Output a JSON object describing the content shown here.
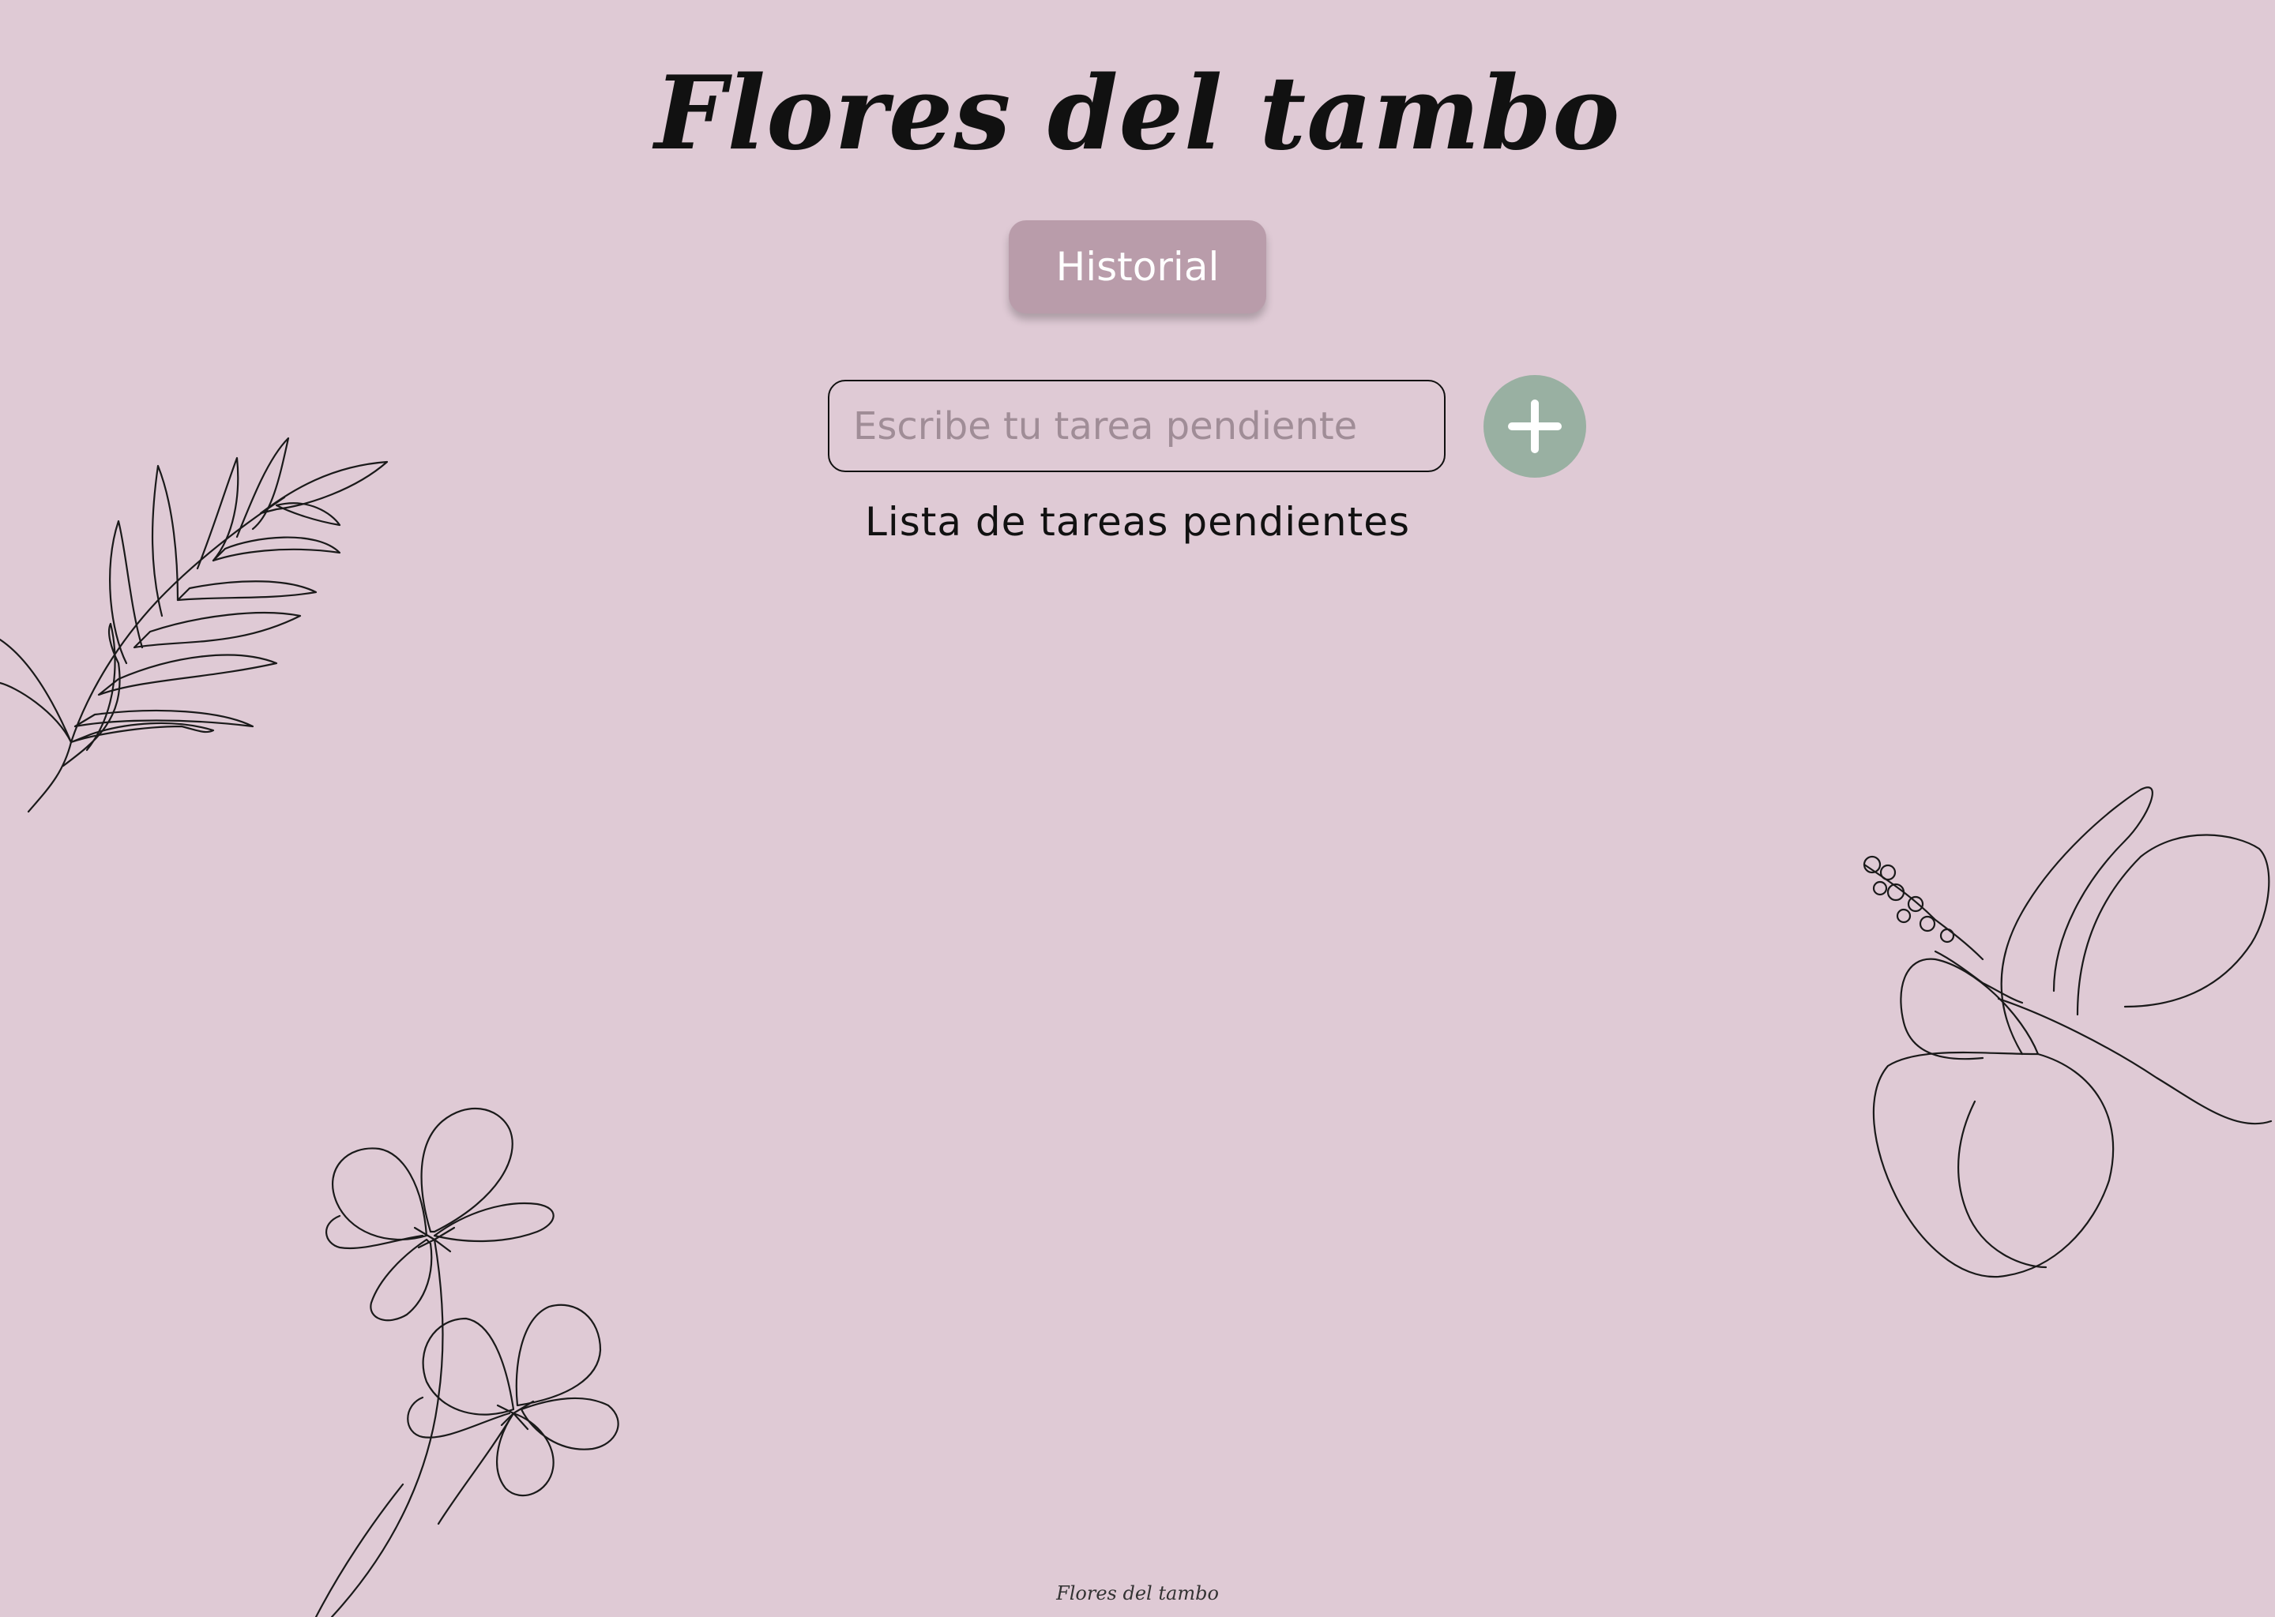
{
  "app": {
    "title": "Flores del tambo",
    "footer": "Flores del tambo"
  },
  "header": {
    "historial_label": "Historial"
  },
  "task_form": {
    "placeholder": "Escribe tu tarea pendiente",
    "value": "",
    "add_icon": "plus-icon"
  },
  "task_list": {
    "heading": "Lista de tareas pendientes",
    "items": []
  },
  "decorations": [
    "fern-branch-illustration",
    "hibiscus-illustration",
    "poppy-flowers-illustration"
  ],
  "colors": {
    "background": "#dfcad5",
    "historial_button": "#b99caa",
    "add_button": "#99b0a2",
    "text": "#111111"
  }
}
